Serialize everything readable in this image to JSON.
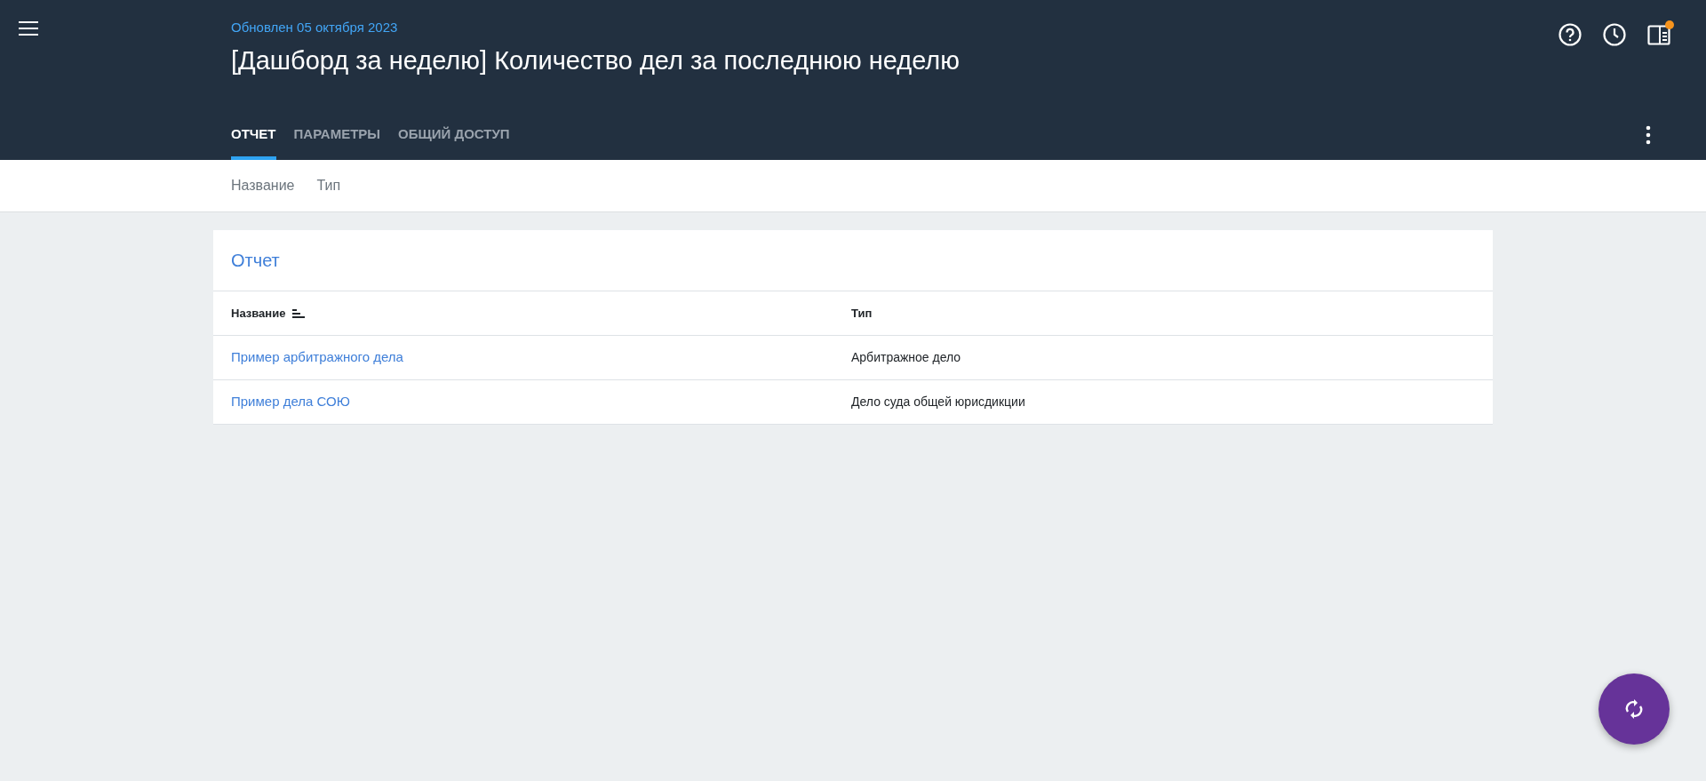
{
  "header": {
    "updated": "Обновлен 05 октября 2023",
    "title": "[Дашборд за неделю] Количество дел за последнюю неделю",
    "panel_notification": true
  },
  "tabs": [
    {
      "label": "ОТЧЕТ",
      "selected": true
    },
    {
      "label": "ПАРАМЕТРЫ",
      "selected": false
    },
    {
      "label": "ОБЩИЙ ДОСТУП",
      "selected": false
    }
  ],
  "filters": [
    "Название",
    "Тип"
  ],
  "report": {
    "title": "Отчет",
    "columns": [
      {
        "label": "Название",
        "sorted": true
      },
      {
        "label": "Тип",
        "sorted": false
      }
    ],
    "rows": [
      {
        "name": "Пример арбитражного дела",
        "type": "Арбитражное дело"
      },
      {
        "name": "Пример дела СОЮ",
        "type": "Дело суда общей юрисдикции"
      }
    ]
  }
}
